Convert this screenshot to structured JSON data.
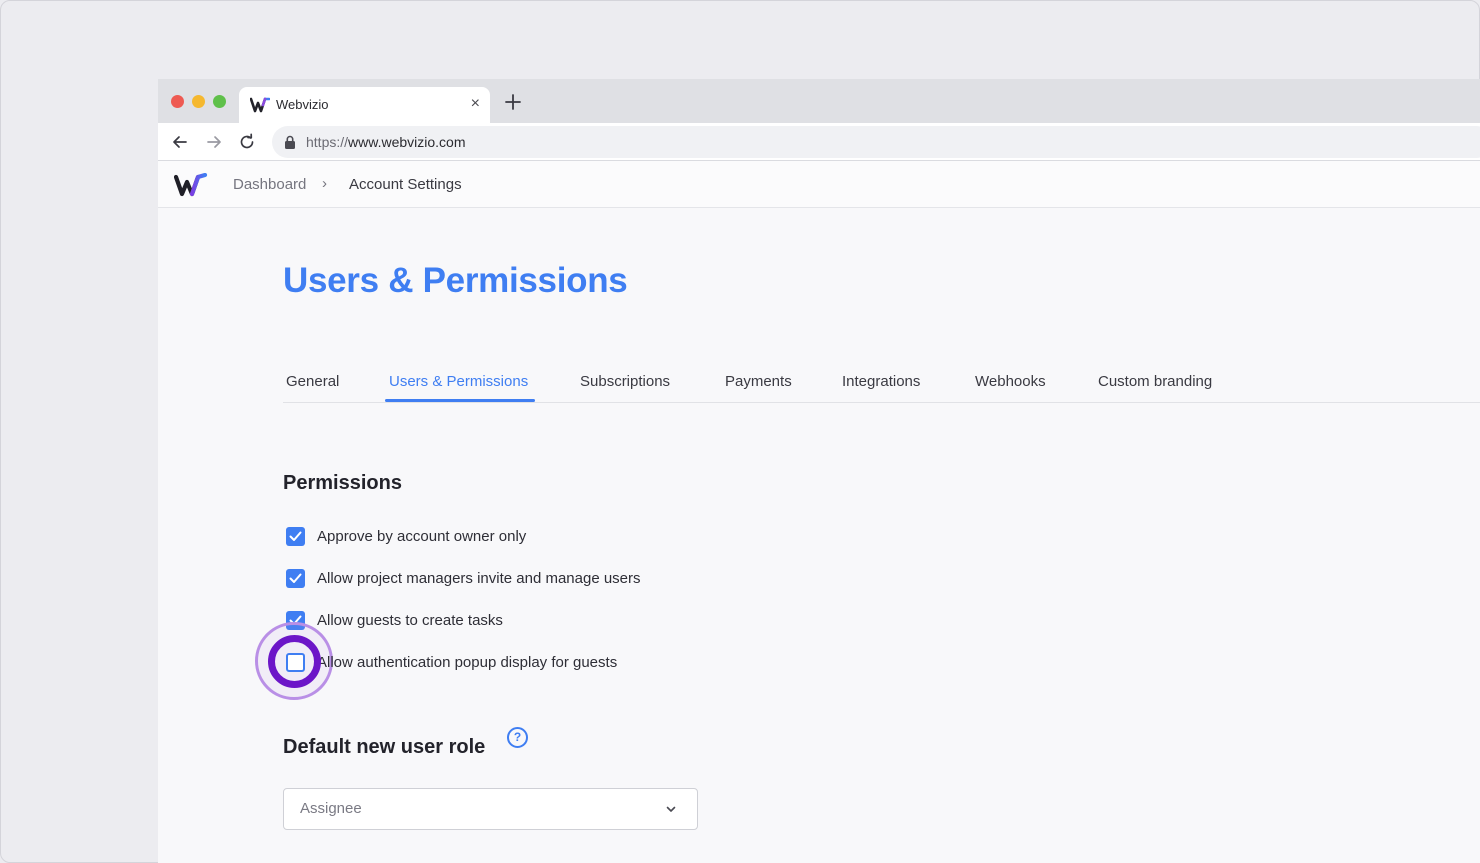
{
  "browser": {
    "tab_title": "Webvizio",
    "tab_close_glyph": "×",
    "url_protocol": "https://",
    "url_host": "www.webvizio.com"
  },
  "breadcrumb": {
    "items": [
      "Dashboard",
      "Account Settings"
    ],
    "separator": "›"
  },
  "page": {
    "title": "Users & Permissions"
  },
  "tabs": [
    {
      "label": "General",
      "active": false
    },
    {
      "label": "Users & Permissions",
      "active": true
    },
    {
      "label": "Subscriptions",
      "active": false
    },
    {
      "label": "Payments",
      "active": false
    },
    {
      "label": "Integrations",
      "active": false
    },
    {
      "label": "Webhooks",
      "active": false
    },
    {
      "label": "Custom branding",
      "active": false
    }
  ],
  "permissions": {
    "title": "Permissions",
    "items": [
      {
        "label": "Approve by account owner only",
        "checked": true
      },
      {
        "label": "Allow project managers invite and manage users",
        "checked": true
      },
      {
        "label": "Allow guests to create tasks",
        "checked": true
      },
      {
        "label": "Allow authentication popup display for guests",
        "checked": false
      }
    ]
  },
  "default_role": {
    "title": "Default new user role",
    "help_glyph": "?",
    "selected": "Assignee"
  },
  "colors": {
    "accent": "#3f7ef2",
    "highlight_ring": "#6c16c8",
    "highlight_glow": "#b98fe6"
  },
  "icons": {
    "tab_favicon": "webvizio-logo-icon",
    "close": "close-icon",
    "new_tab": "plus-icon",
    "back": "arrow-left-icon",
    "forward": "arrow-right-icon",
    "reload": "reload-icon",
    "lock": "lock-icon",
    "help": "question-circle-icon",
    "dropdown": "chevron-down-icon"
  }
}
